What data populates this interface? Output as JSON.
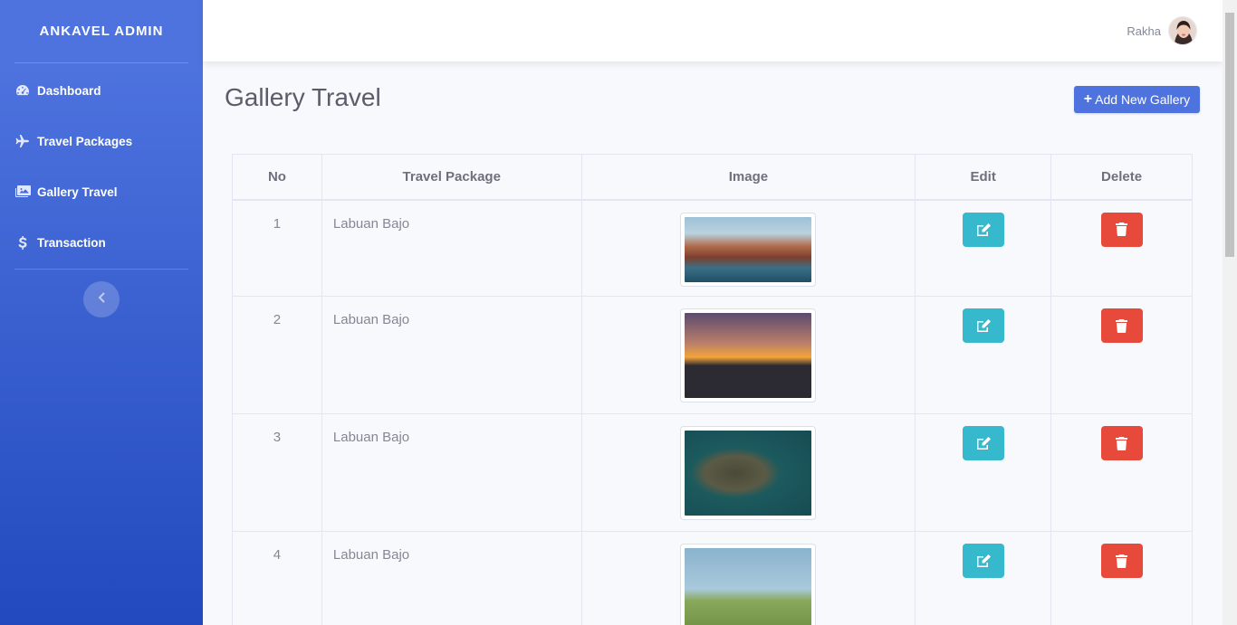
{
  "brand": "ANKAVEL ADMIN",
  "sidebar": {
    "items": [
      {
        "label": "Dashboard",
        "icon": "tachometer-icon"
      },
      {
        "label": "Travel Packages",
        "icon": "plane-icon"
      },
      {
        "label": "Gallery Travel",
        "icon": "images-icon"
      },
      {
        "label": "Transaction",
        "icon": "dollar-icon"
      }
    ],
    "toggle_icon": "chevron-left-icon"
  },
  "topbar": {
    "user_name": "Rakha"
  },
  "page": {
    "title": "Gallery Travel",
    "add_button": "Add New Gallery"
  },
  "table": {
    "headers": [
      "No",
      "Travel Package",
      "Image",
      "Edit",
      "Delete"
    ],
    "rows": [
      {
        "no": "1",
        "package": "Labuan Bajo"
      },
      {
        "no": "2",
        "package": "Labuan Bajo"
      },
      {
        "no": "3",
        "package": "Labuan Bajo"
      },
      {
        "no": "4",
        "package": "Labuan Bajo"
      }
    ]
  },
  "colors": {
    "primary": "#4e73df",
    "info": "#36b9cc",
    "danger": "#e74a3b"
  }
}
